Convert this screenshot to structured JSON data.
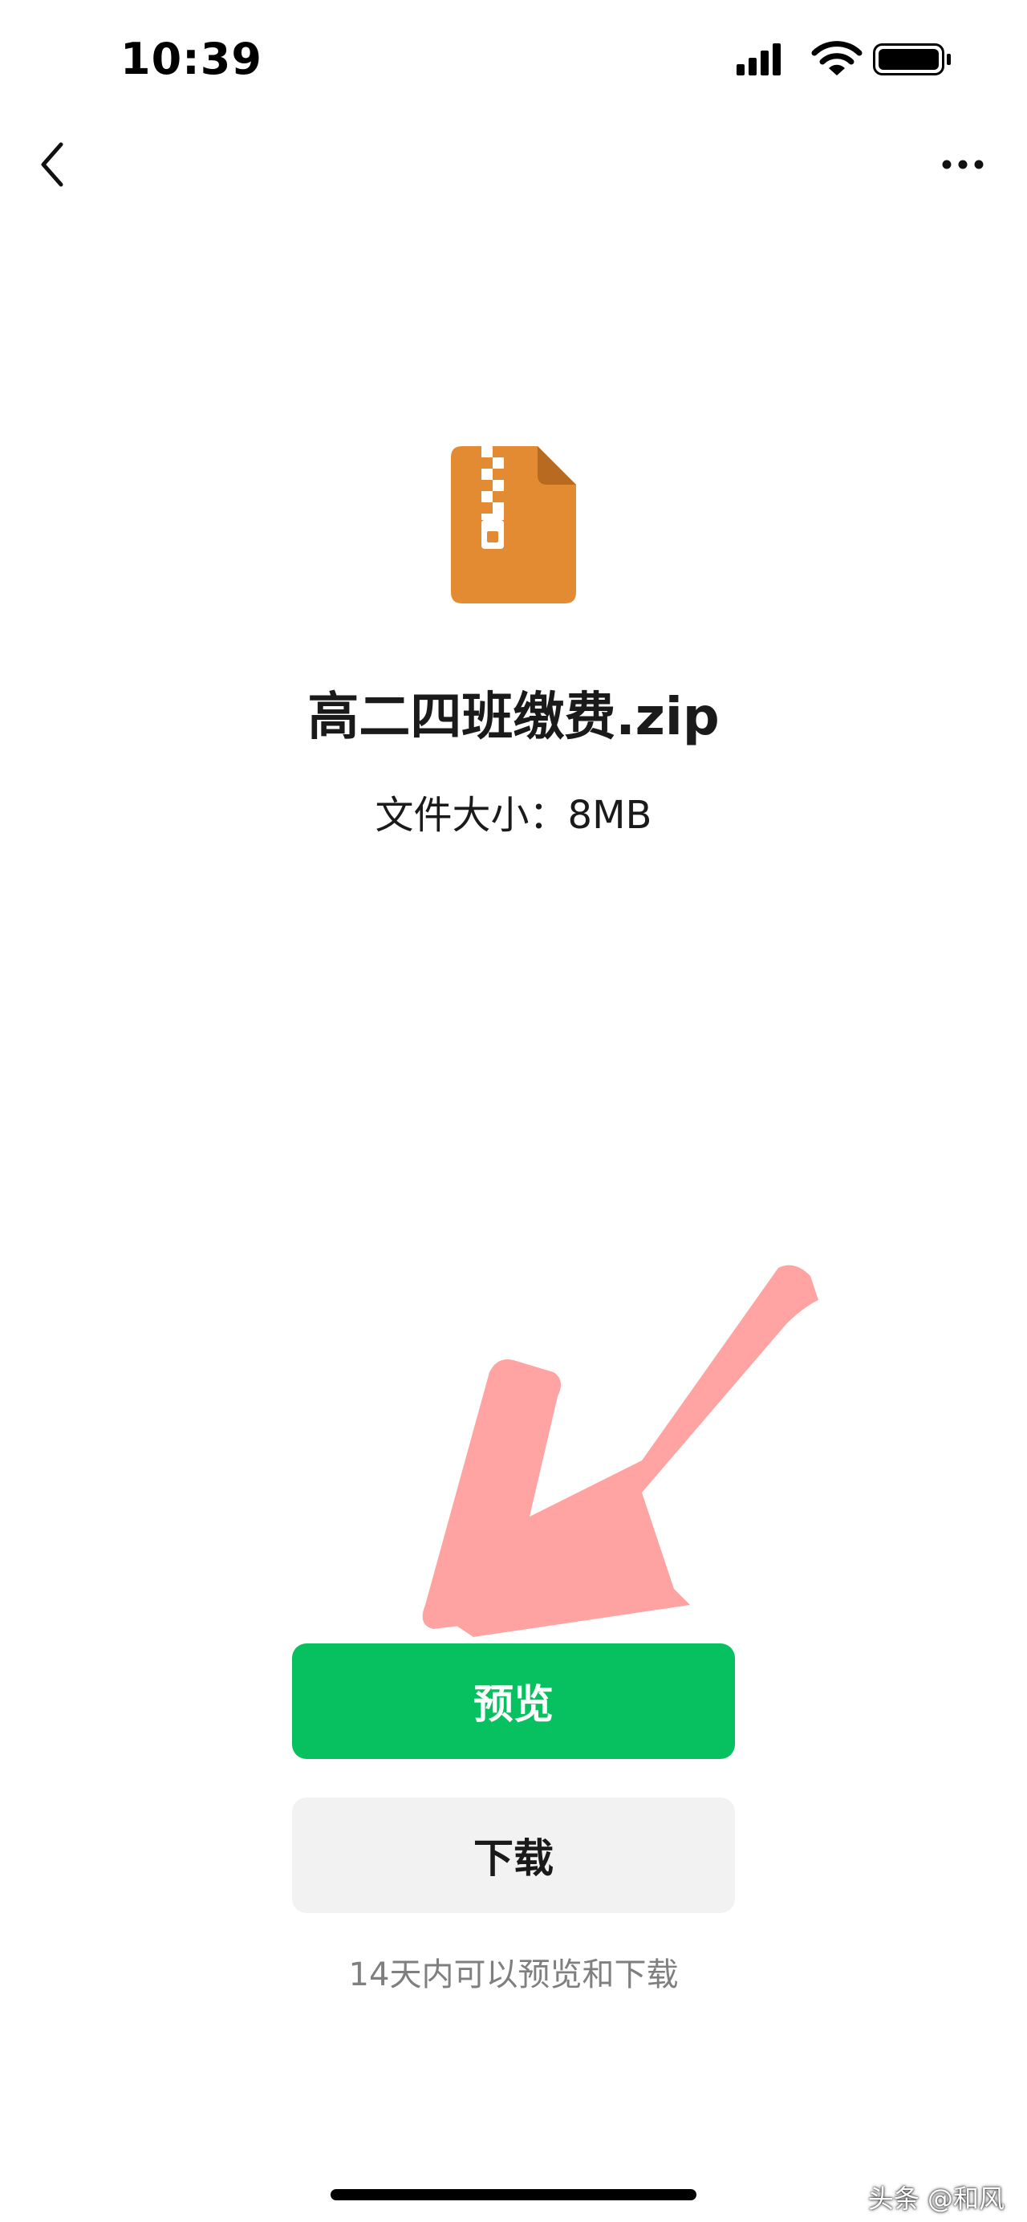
{
  "status_bar": {
    "time": "10:39",
    "icons": [
      "cellular-signal-icon",
      "wifi-icon",
      "battery-icon"
    ]
  },
  "nav": {
    "back_icon": "chevron-left-icon",
    "more_icon": "more-dots-icon"
  },
  "file": {
    "icon": "zip-file-icon",
    "icon_color": "#E38B33",
    "name": "高二四班缴费.zip",
    "size_text": "文件大小：8MB"
  },
  "annotation": {
    "icon": "hand-drawn-arrow",
    "color": "#FF9A99"
  },
  "actions": {
    "preview_label": "预览",
    "download_label": "下载",
    "preview_color": "#07C160",
    "download_color": "#F2F2F2"
  },
  "note": "14天内可以预览和下载",
  "watermark": "头条 @和风"
}
